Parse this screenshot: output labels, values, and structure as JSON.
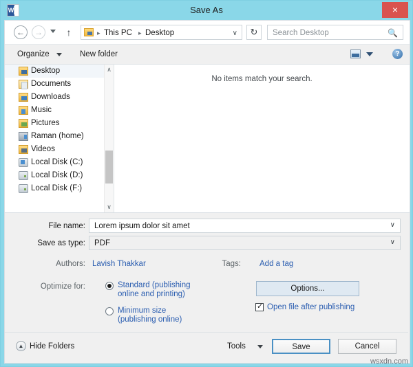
{
  "window": {
    "title": "Save As",
    "app_icon": "word-icon",
    "close_label": "×",
    "titlebar_color": "#8ad7e8",
    "close_color": "#d9534f"
  },
  "addressbar": {
    "back_glyph": "←",
    "forward_glyph": "→",
    "up_glyph": "↑",
    "recent_caret": "",
    "refresh_glyph": "↻",
    "breadcrumb": [
      "This PC",
      "Desktop"
    ],
    "breadcrumb_separator": "▸",
    "dropdown_chevron": "∨",
    "search_placeholder": "Search Desktop",
    "search_value": "",
    "search_icon": "search-icon"
  },
  "toolbar": {
    "organize_label": "Organize",
    "new_folder_label": "New folder",
    "view_icon": "view-layout-icon",
    "view_caret": "",
    "help_label": "?"
  },
  "navpane": {
    "items": [
      {
        "label": "Desktop",
        "icon": "folder-desktop-icon",
        "selected": true
      },
      {
        "label": "Documents",
        "icon": "folder-documents-icon",
        "selected": false
      },
      {
        "label": "Downloads",
        "icon": "folder-downloads-icon",
        "selected": false
      },
      {
        "label": "Music",
        "icon": "folder-music-icon",
        "selected": false
      },
      {
        "label": "Pictures",
        "icon": "folder-pictures-icon",
        "selected": false
      },
      {
        "label": "Raman (home)",
        "icon": "home-group-icon",
        "selected": false
      },
      {
        "label": "Videos",
        "icon": "folder-videos-icon",
        "selected": false
      },
      {
        "label": "Local Disk (C:)",
        "icon": "hard-disk-icon",
        "selected": false
      },
      {
        "label": "Local Disk (D:)",
        "icon": "drive-icon",
        "selected": false
      },
      {
        "label": "Local Disk (F:)",
        "icon": "drive-icon",
        "selected": false
      }
    ],
    "scroll_up_glyph": "∧",
    "scroll_down_glyph": "∨"
  },
  "filepane": {
    "empty_message": "No items match your search."
  },
  "form": {
    "file_name_label": "File name:",
    "file_name_value": "Lorem ipsum dolor sit amet",
    "file_name_chevron": "∨",
    "save_as_type_label": "Save as type:",
    "save_as_type_value": "PDF",
    "save_as_type_chevron": "∨",
    "authors_label": "Authors:",
    "authors_value": "Lavish Thakkar",
    "tags_label": "Tags:",
    "tags_value": "Add a tag",
    "optimize_label": "Optimize for:",
    "optimize_options": [
      {
        "line1": "Standard (publishing",
        "line2": "online and printing)",
        "selected": true
      },
      {
        "line1": "Minimum size",
        "line2": "(publishing online)",
        "selected": false
      }
    ],
    "options_button_label": "Options...",
    "open_after_publishing_label": "Open file after publishing",
    "open_after_publishing_checked": true
  },
  "footer": {
    "hide_folders_label": "Hide Folders",
    "hide_folders_glyph": "▲",
    "tools_label": "Tools",
    "save_label": "Save",
    "cancel_label": "Cancel"
  },
  "watermark": "wsxdn.com"
}
